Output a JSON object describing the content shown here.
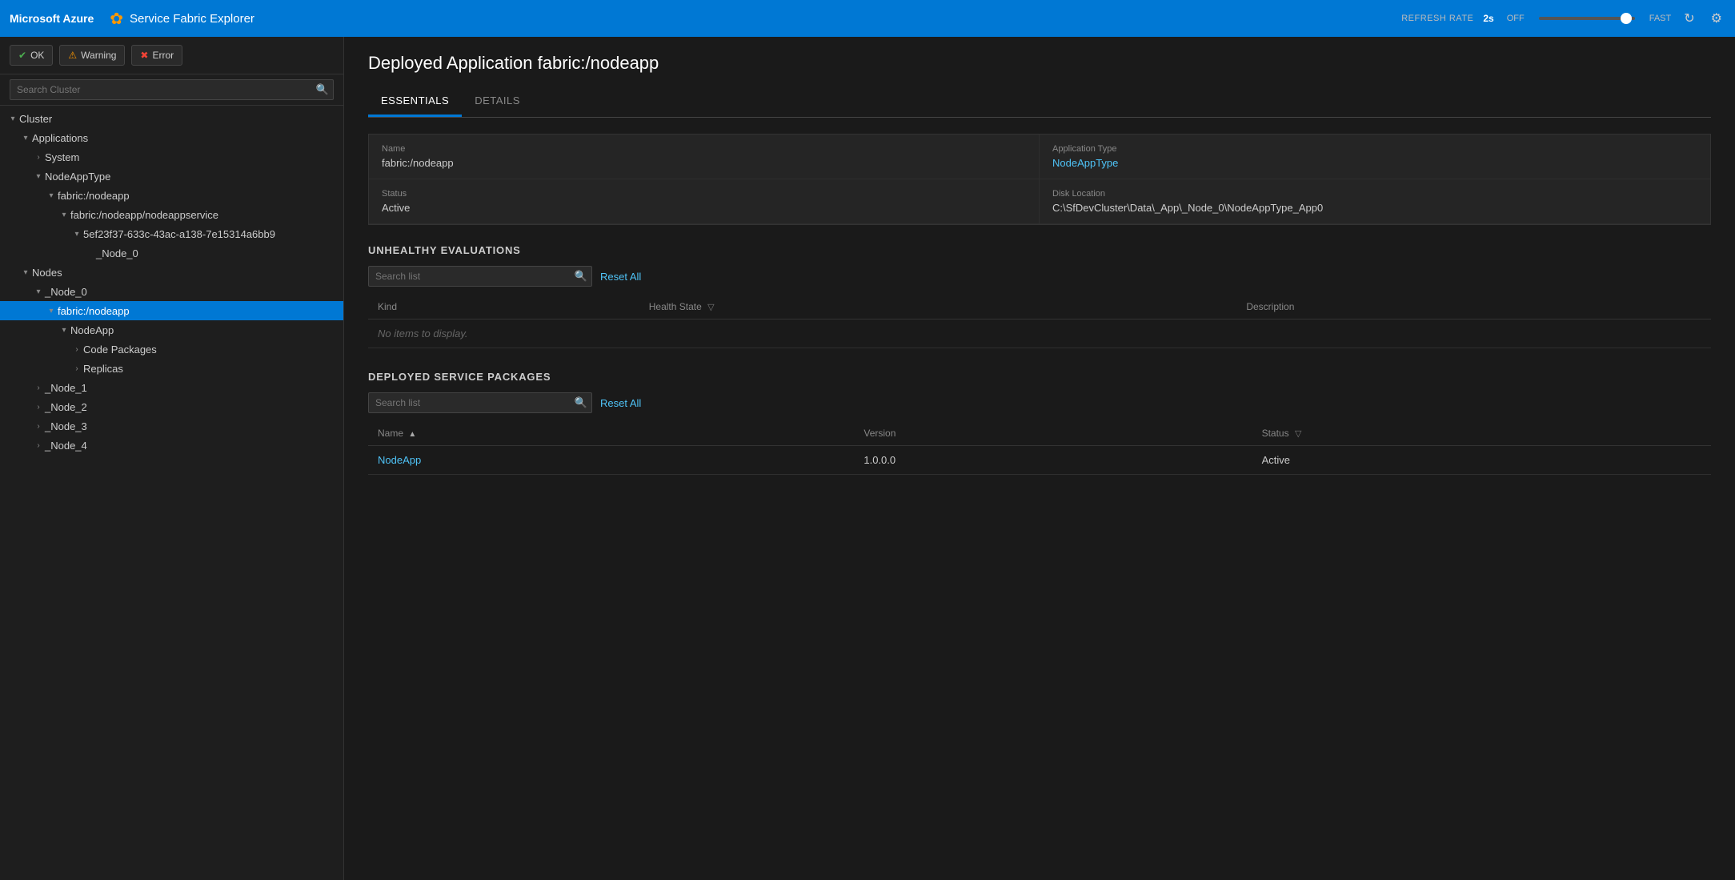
{
  "topbar": {
    "brand": "Microsoft Azure",
    "app_name": "Service Fabric Explorer",
    "refresh_label": "REFRESH RATE",
    "refresh_rate": "2s",
    "off_label": "OFF",
    "fast_label": "FAST"
  },
  "filters": {
    "ok_label": "OK",
    "warning_label": "Warning",
    "error_label": "Error"
  },
  "search": {
    "placeholder": "Search Cluster"
  },
  "tree": [
    {
      "id": "cluster",
      "label": "Cluster",
      "indent": "indent1",
      "state": "open"
    },
    {
      "id": "applications",
      "label": "Applications",
      "indent": "indent2",
      "state": "open"
    },
    {
      "id": "system",
      "label": "System",
      "indent": "indent3",
      "state": "closed"
    },
    {
      "id": "nodeapptype",
      "label": "NodeAppType",
      "indent": "indent3",
      "state": "open"
    },
    {
      "id": "fabric-nodeapp",
      "label": "fabric:/nodeapp",
      "indent": "indent4",
      "state": "open"
    },
    {
      "id": "fabric-nodeappservice",
      "label": "fabric:/nodeapp/nodeappservice",
      "indent": "indent5",
      "state": "open"
    },
    {
      "id": "partition",
      "label": "5ef23f37-633c-43ac-a138-7e15314a6bb9",
      "indent": "indent6",
      "state": "closed"
    },
    {
      "id": "node0-instance",
      "label": "_Node_0",
      "indent": "indent6",
      "state": "leaf"
    },
    {
      "id": "nodes",
      "label": "Nodes",
      "indent": "indent2",
      "state": "open"
    },
    {
      "id": "node0",
      "label": "_Node_0",
      "indent": "indent3",
      "state": "open"
    },
    {
      "id": "fabric-nodeapp-node",
      "label": "fabric:/nodeapp",
      "indent": "indent4",
      "state": "open",
      "selected": true
    },
    {
      "id": "nodeapp-pkg",
      "label": "NodeApp",
      "indent": "indent5",
      "state": "open"
    },
    {
      "id": "code-packages",
      "label": "Code Packages",
      "indent": "indent6",
      "state": "closed"
    },
    {
      "id": "replicas",
      "label": "Replicas",
      "indent": "indent6",
      "state": "closed"
    },
    {
      "id": "node1",
      "label": "_Node_1",
      "indent": "indent3",
      "state": "closed"
    },
    {
      "id": "node2",
      "label": "_Node_2",
      "indent": "indent3",
      "state": "closed"
    },
    {
      "id": "node3",
      "label": "_Node_3",
      "indent": "indent3",
      "state": "closed"
    },
    {
      "id": "node4",
      "label": "_Node_4",
      "indent": "indent3",
      "state": "closed"
    }
  ],
  "page": {
    "title_prefix": "Deployed Application",
    "title_name": "fabric:/nodeapp",
    "tab_essentials": "ESSENTIALS",
    "tab_details": "DETAILS"
  },
  "essentials": {
    "name_label": "Name",
    "name_value": "fabric:/nodeapp",
    "app_type_label": "Application Type",
    "app_type_value": "NodeAppType",
    "status_label": "Status",
    "status_value": "Active",
    "disk_label": "Disk Location",
    "disk_value": "C:\\SfDevCluster\\Data\\_App\\_Node_0\\NodeAppType_App0"
  },
  "unhealthy": {
    "section_title": "UNHEALTHY EVALUATIONS",
    "search_placeholder": "Search list",
    "reset_label": "Reset All",
    "col_kind": "Kind",
    "col_health_state": "Health State",
    "col_description": "Description",
    "empty_message": "No items to display.",
    "items": []
  },
  "deployed_packages": {
    "section_title": "DEPLOYED SERVICE PACKAGES",
    "search_placeholder": "Search list",
    "reset_label": "Reset All",
    "col_name": "Name",
    "col_version": "Version",
    "col_status": "Status",
    "items": [
      {
        "name": "NodeApp",
        "version": "1.0.0.0",
        "status": "Active"
      }
    ]
  }
}
